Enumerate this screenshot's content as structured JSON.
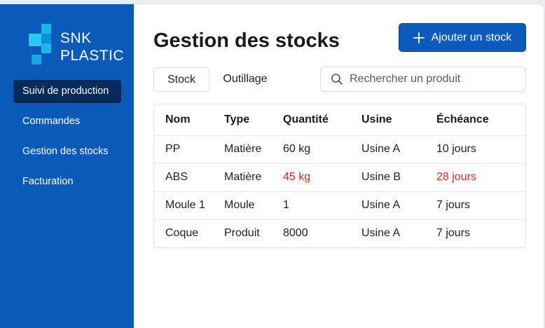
{
  "brand": {
    "line1": "SNK",
    "line2": "PLASTIC"
  },
  "colors": {
    "sidebar": "#0a5ab9",
    "active": "#062a59",
    "accent": "#0b5bbd",
    "alert": "#e3261f",
    "logo_cyan": "#19b7e7"
  },
  "sidebar": {
    "items": [
      {
        "label": "Suivi de production",
        "active": true
      },
      {
        "label": "Commandes",
        "active": false
      },
      {
        "label": "Gestion des stocks",
        "active": false
      },
      {
        "label": "Facturation",
        "active": false
      }
    ]
  },
  "header": {
    "title": "Gestion des stocks",
    "add_button": "Ajouter un stock",
    "add_icon": "plus-icon"
  },
  "tabs": [
    {
      "label": "Stock",
      "selected": true
    },
    {
      "label": "Outillage",
      "selected": false
    }
  ],
  "search": {
    "placeholder": "Rechercher un produit",
    "value": "",
    "icon": "search-icon"
  },
  "table": {
    "columns": [
      "Nom",
      "Type",
      "Quantité",
      "Usine",
      "Échéance"
    ],
    "rows": [
      {
        "nom": "PP",
        "type": "Matière",
        "quantite": "60 kg",
        "usine": "Usine A",
        "echeance": "10 jours",
        "alert": false
      },
      {
        "nom": "ABS",
        "type": "Matière",
        "quantite": "45 kg",
        "usine": "Usine B",
        "echeance": "28 jours",
        "alert": true
      },
      {
        "nom": "Moule 1",
        "type": "Moule",
        "quantite": "1",
        "usine": "Usine A",
        "echeance": "7 jours",
        "alert": false
      },
      {
        "nom": "Coque",
        "type": "Produit",
        "quantite": "8000",
        "usine": "Usine A",
        "echeance": "7 jours",
        "alert": false
      }
    ]
  }
}
